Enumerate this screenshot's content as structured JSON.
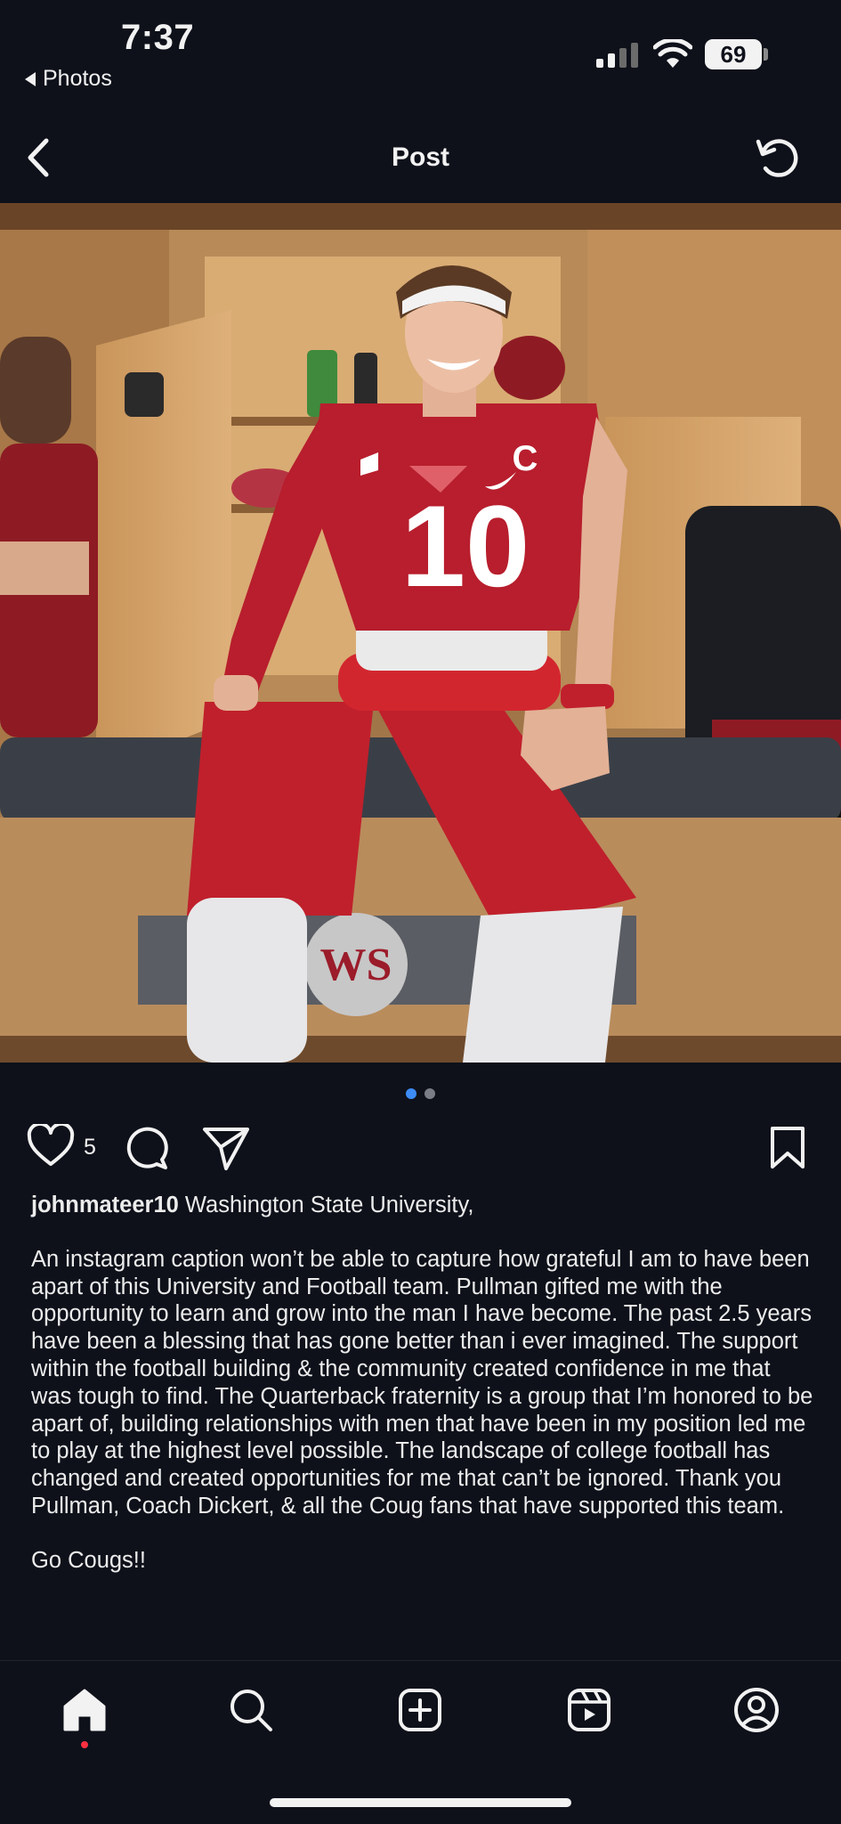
{
  "status": {
    "time": "7:37",
    "back_app": "Photos",
    "battery": "69"
  },
  "header": {
    "title": "Post"
  },
  "photo": {
    "jersey_number": "10",
    "captain_letter": "C",
    "colors": {
      "crimson": "#b81e2d",
      "locker": "#c89a5e",
      "floor": "#3a3f47"
    }
  },
  "carousel": {
    "total": 2,
    "active": 1,
    "active_color": "#3d8bf5",
    "inactive_color": "#7a7d85"
  },
  "actions": {
    "like_count": "5"
  },
  "caption": {
    "username": "johnmateer10",
    "headline": "Washington State University,",
    "body": "An instagram caption won’t be able to capture how grateful I am to have been apart of this University and Football team. Pullman gifted me with the opportunity to learn and grow into the man I have become. The past 2.5 years have been a blessing that has gone better than i ever imagined. The support within the football building & the community created confidence in me that was tough to find. The Quarterback fraternity is a group that I’m honored to be apart of, building relationships with men that have been in my position led me to play at the highest level possible. The landscape of college football has changed and created opportunities for me that can’t be ignored. Thank you Pullman, Coach Dickert, & all the Coug fans that have supported this team.",
    "signoff": "Go Cougs!!"
  },
  "nav": {
    "items": [
      "home-icon",
      "search-icon",
      "create-icon",
      "reels-icon",
      "profile-icon"
    ],
    "active": "home-icon"
  }
}
